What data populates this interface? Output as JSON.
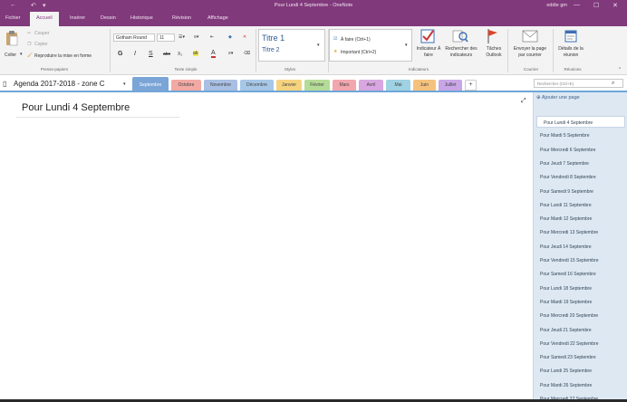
{
  "window": {
    "title": "Pour Lundi 4 Septembre  -  OneNote",
    "user": "eddie gm",
    "minimize_glyph": "—",
    "maximize_glyph": "☐",
    "close_glyph": "✕",
    "back_glyph": "←",
    "undo_glyph": "↶",
    "qa_dropdown_glyph": "▾"
  },
  "menu": {
    "tabs": [
      "Fichier",
      "Accueil",
      "Insérer",
      "Dessin",
      "Historique",
      "Révision",
      "Affichage"
    ]
  },
  "ribbon": {
    "clipboard": {
      "paste": "Coller",
      "cut": "Couper",
      "copy": "Copier",
      "format_painter": "Reproduire la mise en forme",
      "label": "Presse-papiers"
    },
    "basic_text": {
      "font": "Gotham Round",
      "size": "11",
      "bold": "G",
      "italic": "I",
      "underline": "S",
      "strike": "abc",
      "subscript": "X₂",
      "highlight": "ab",
      "font_color": "A",
      "clear": "A",
      "label": "Texte simple"
    },
    "styles": {
      "title1": "Titre 1",
      "title2": "Titre 2",
      "label": "Styles"
    },
    "tags": {
      "todo": "À faire (Ctrl+1)",
      "important": "Important (Ctrl+2)",
      "todo_tag": "Indicateur À faire",
      "find_tags": "Rechercher des indicateurs",
      "outlook_tasks": "Tâches Outlook",
      "label": "Indicateurs"
    },
    "email": {
      "send": "Envoyer la page par courrier",
      "label": "Courrier"
    },
    "meetings": {
      "details": "Détails de la réunion",
      "label": "Réunions"
    }
  },
  "notebook": {
    "name": "Agenda 2017-2018 - zone C",
    "search_placeholder": "Rechercher (Ctrl+E)",
    "add_section": "+",
    "dropdown_glyph": "▾",
    "sections": [
      {
        "label": "Septembre",
        "color": "#7aa5d6"
      },
      {
        "label": "Octobre",
        "color": "#f2a9a4"
      },
      {
        "label": "Novembre",
        "color": "#a9bfe3"
      },
      {
        "label": "Décembre",
        "color": "#a7c7e7"
      },
      {
        "label": "Janvier",
        "color": "#f5d37e"
      },
      {
        "label": "Février",
        "color": "#b4dc97"
      },
      {
        "label": "Mars",
        "color": "#f2a6ae"
      },
      {
        "label": "Avril",
        "color": "#d8a6e0"
      },
      {
        "label": "Mai",
        "color": "#9fd2e3"
      },
      {
        "label": "Juin",
        "color": "#f5c27e"
      },
      {
        "label": "Juillet",
        "color": "#c9a6e6"
      }
    ]
  },
  "page": {
    "title": "Pour Lundi 4 Septembre",
    "expand_glyph": "⤢"
  },
  "pages_pane": {
    "add_page": "Ajouter une page",
    "pages": [
      "Pour Lundi 4 Septembre",
      "Pour Mardi 5 Septembre",
      "Pour Mercredi 6 Septembre",
      "Pour Jeudi 7 Septembre",
      "Pour Vendredi 8 Septembre",
      "Pour Samedi 9 Septembre",
      "Pour Lundi 11 Septembre",
      "Pour Mardi 12 Septembre",
      "Pour Mercredi 13 Septembre",
      "Pour Jeudi 14 Septembre",
      "Pour Vendredi 15 Septembre",
      "Pour Samedi 16 Septembre",
      "Pour Lundi 18 Septembre",
      "Pour Mardi 19 Septembre",
      "Pour Mercredi 20 Septembre",
      "Pour Jeudi 21 Septembre",
      "Pour Vendredi 22 Septembre",
      "Pour Samedi 23 Septembre",
      "Pour Lundi 25 Septembre",
      "Pour Mardi 26 Septembre",
      "Pour Mercredi 27 Septembre"
    ]
  },
  "colors": {
    "accent": "#80397b",
    "ribbon_bg": "#f3f3f3",
    "pane_bg": "#dde8f3"
  }
}
